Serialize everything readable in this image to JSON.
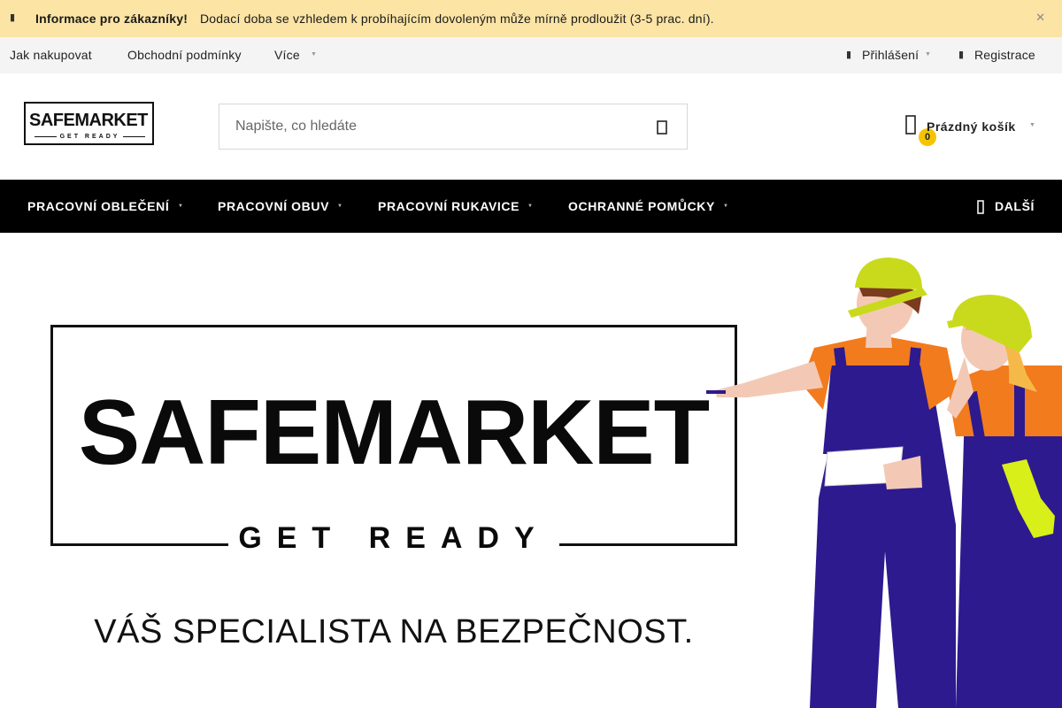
{
  "info_bar": {
    "strong": "Informace pro zákazníky!",
    "text": "Dodací doba se vzhledem k probíhajícím dovoleným může mírně prodloužit (3-5 prac. dní).",
    "bg_color": "#fbe4a4"
  },
  "top_nav": {
    "links": [
      "Jak nakupovat",
      "Obchodní podmínky",
      "Více"
    ],
    "login": "Přihlášení",
    "register": "Registrace"
  },
  "header": {
    "logo_title": "SAFEMARKET",
    "logo_sub": "GET READY",
    "search_placeholder": "Napište, co hledáte",
    "cart_label": "Prázdný košík",
    "cart_count": "0",
    "badge_color": "#f5c400"
  },
  "main_nav": {
    "items": [
      "PRACOVNÍ OBLEČENÍ",
      "PRACOVNÍ OBUV",
      "PRACOVNÍ RUKAVICE",
      "OCHRANNÉ POMŮCKY"
    ],
    "more": "DALŠÍ"
  },
  "hero": {
    "title": "SAFEMARKET",
    "subtitle": "GET READY",
    "tagline": "VÁŠ SPECIALISTA NA BEZPEČNOST."
  }
}
